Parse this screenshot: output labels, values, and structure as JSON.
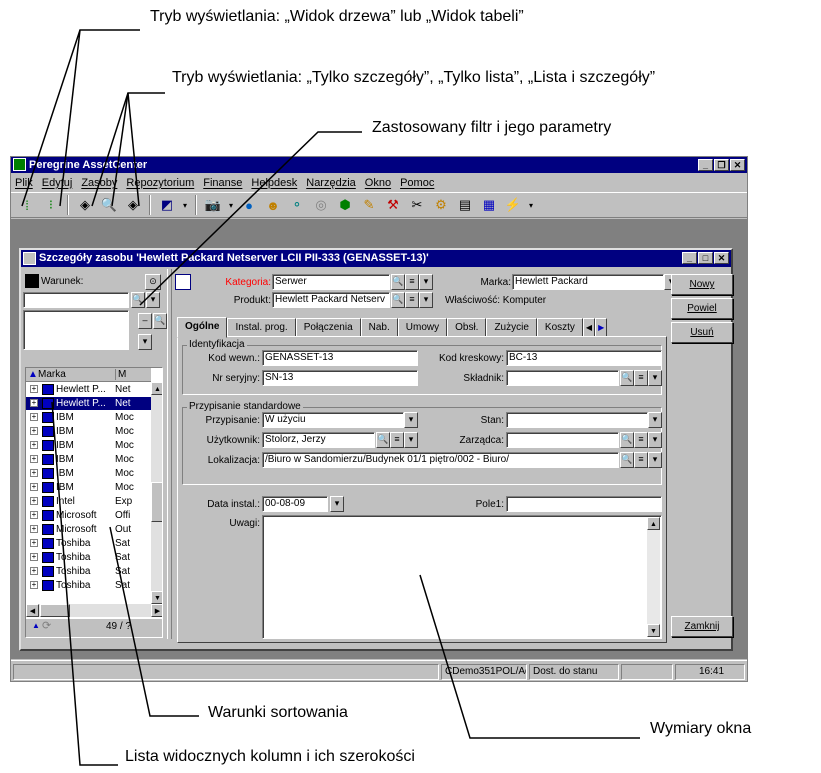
{
  "annotations": {
    "view_mode": "Tryb wyświetlania: „Widok drzewa” lub „Widok tabeli”",
    "detail_mode": "Tryb wyświetlania: „Tylko szczegóły”, „Tylko lista”, „Lista i szczegóły”",
    "filter": "Zastosowany filtr i jego parametry",
    "sorting": "Warunki sortowania",
    "window_size": "Wymiary okna",
    "columns": "Lista widocznych kolumn i ich szerokości"
  },
  "app": {
    "title": "Peregrine AssetCenter",
    "menu": [
      "Plik",
      "Edytuj",
      "Zasoby",
      "Repozytorium",
      "Finanse",
      "Helpdesk",
      "Narzędzia",
      "Okno",
      "Pomoc"
    ]
  },
  "child": {
    "title": "Szczegóły zasobu 'Hewlett Packard Netserver LCII PII-333 (GENASSET-13)'",
    "filter_label": "Warunek:",
    "list": {
      "header_col1": "Marka",
      "header_col2": "M",
      "rows": [
        {
          "c1": "Hewlett P...",
          "c2": "Net"
        },
        {
          "c1": "Hewlett P...",
          "c2": "Net"
        },
        {
          "c1": "IBM",
          "c2": "Moc"
        },
        {
          "c1": "IBM",
          "c2": "Moc"
        },
        {
          "c1": "IBM",
          "c2": "Moc"
        },
        {
          "c1": "IBM",
          "c2": "Moc"
        },
        {
          "c1": "IBM",
          "c2": "Moc"
        },
        {
          "c1": "IBM",
          "c2": "Moc"
        },
        {
          "c1": "Intel",
          "c2": "Exp"
        },
        {
          "c1": "Microsoft",
          "c2": "Offi"
        },
        {
          "c1": "Microsoft",
          "c2": "Out"
        },
        {
          "c1": "Toshiba",
          "c2": "Sat"
        },
        {
          "c1": "Toshiba",
          "c2": "Sat"
        },
        {
          "c1": "Toshiba",
          "c2": "Sat"
        },
        {
          "c1": "Toshiba",
          "c2": "Sat"
        }
      ],
      "counter": "49 / ?"
    },
    "header": {
      "kategoria_label": "Kategoria:",
      "kategoria_value": "Serwer",
      "marka_label": "Marka:",
      "marka_value": "Hewlett Packard",
      "produkt_label": "Produkt:",
      "produkt_value": "Hewlett Packard Netserv",
      "wlasciwosc": "Właściwość: Komputer"
    },
    "tabs": [
      "Ogólne",
      "Instal. prog.",
      "Połączenia",
      "Nab.",
      "Umowy",
      "Obsł.",
      "Zużycie",
      "Koszty"
    ],
    "ident": {
      "title": "Identyfikacja",
      "kod_wewn_label": "Kod wewn.:",
      "kod_wewn_value": "GENASSET-13",
      "kod_kresk_label": "Kod kreskowy:",
      "kod_kresk_value": "BC-13",
      "nr_ser_label": "Nr seryjny:",
      "nr_ser_value": "SN-13",
      "skladnik_label": "Składnik:",
      "skladnik_value": ""
    },
    "przyp": {
      "title": "Przypisanie standardowe",
      "przypisanie_label": "Przypisanie:",
      "przypisanie_value": "W użyciu",
      "stan_label": "Stan:",
      "stan_value": "",
      "uzytkownik_label": "Użytkownik:",
      "uzytkownik_value": "Stolorz, Jerzy",
      "zarzadca_label": "Zarządca:",
      "zarzadca_value": "",
      "lokalizacja_label": "Lokalizacja:",
      "lokalizacja_value": "/Biuro w Sandomierzu/Budynek 01/1 piętro/002 - Biuro/"
    },
    "data_instal_label": "Data instal.:",
    "data_instal_value": "00-08-09",
    "pole1_label": "Pole1:",
    "uwagi_label": "Uwagi:",
    "buttons": {
      "nowy": "Nowy",
      "powiel": "Powiel",
      "usun": "Usuń",
      "zamknij": "Zamknij"
    }
  },
  "status": {
    "db": "CDemo351POL/Admin[2",
    "info": "Dost. do stanu",
    "time": "16:41"
  }
}
